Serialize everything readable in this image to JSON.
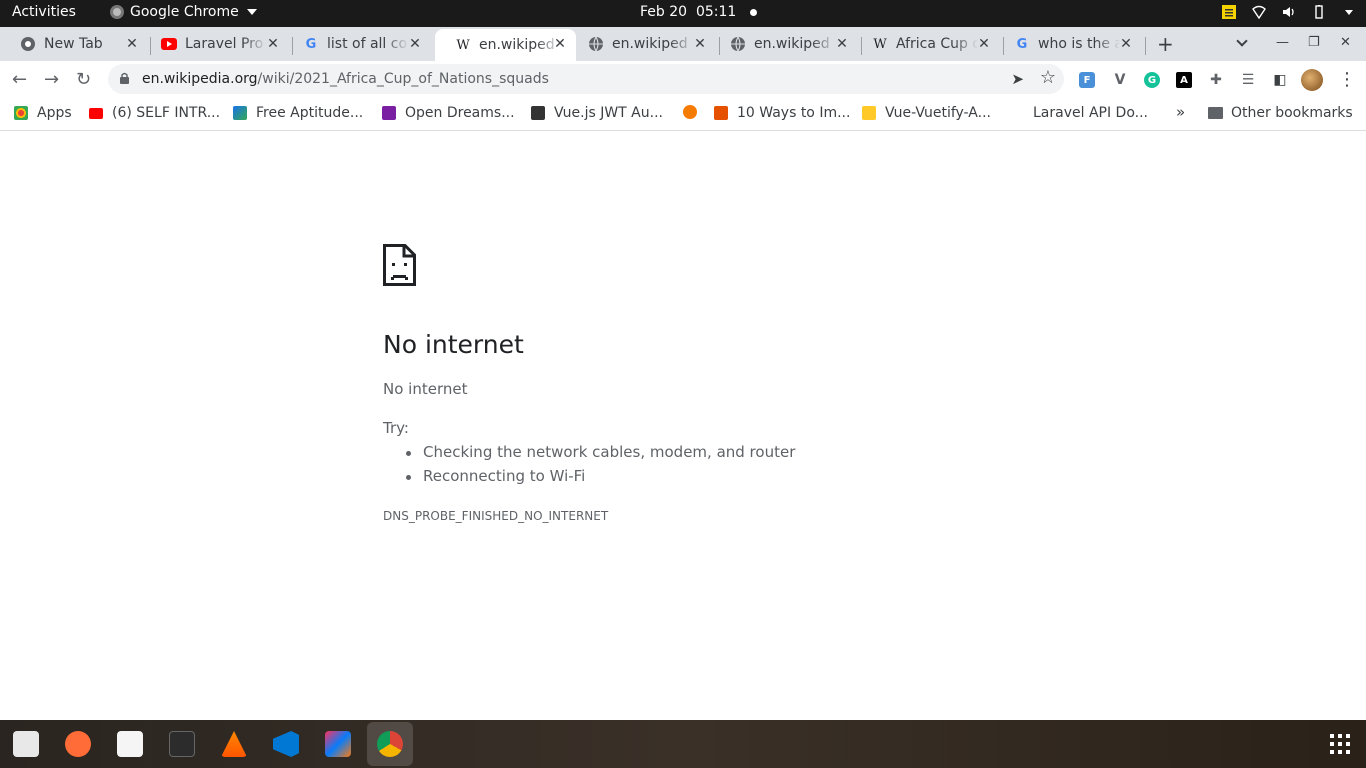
{
  "topbar": {
    "activities": "Activities",
    "app_name": "Google Chrome",
    "date": "Feb 20",
    "time": "05:11"
  },
  "tabs": [
    {
      "title": "New Tab",
      "icon": "chrome-icon"
    },
    {
      "title": "Laravel Pro",
      "icon": "youtube-icon"
    },
    {
      "title": "list of all co",
      "icon": "google-icon"
    },
    {
      "title": "en.wikiped",
      "icon": "wikipedia-icon",
      "active": true
    },
    {
      "title": "en.wikiped",
      "icon": "globe-icon"
    },
    {
      "title": "en.wikiped",
      "icon": "globe-icon"
    },
    {
      "title": "Africa Cup o",
      "icon": "wikipedia-icon"
    },
    {
      "title": "who is the a",
      "icon": "google-icon"
    }
  ],
  "toolbar": {
    "url_domain": "en.wikipedia.org",
    "url_path": "/wiki/2021_Africa_Cup_of_Nations_squads"
  },
  "bookmarks": [
    {
      "label": "Apps",
      "color": "#ea4335"
    },
    {
      "label": "(6) SELF INTR...",
      "color": "#ff0000"
    },
    {
      "label": "Free Aptitude...",
      "color": "#1a73e8"
    },
    {
      "label": "Open Dreams...",
      "color": "#7b1fa2"
    },
    {
      "label": "Vue.js JWT Au...",
      "color": "#333333"
    },
    {
      "label": "",
      "color": "#f57c00"
    },
    {
      "label": "10 Ways to Im...",
      "color": "#e65100"
    },
    {
      "label": "Vue-Vuetify-A...",
      "color": "#ffca28"
    },
    {
      "label": "Laravel API Do...",
      "color": "#ffffff"
    }
  ],
  "bookmarks_more": "»",
  "other_bookmarks": "Other bookmarks",
  "error": {
    "title": "No internet",
    "subtitle": "No internet",
    "try_label": "Try:",
    "suggestions": [
      "Checking the network cables, modem, and router",
      "Reconnecting to Wi-Fi"
    ],
    "code": "DNS_PROBE_FINISHED_NO_INTERNET"
  },
  "dock_apps": [
    "files-icon",
    "postman-icon",
    "text-editor-icon",
    "terminal-icon",
    "vlc-icon",
    "vscode-icon",
    "intellij-icon",
    "chrome-icon"
  ]
}
